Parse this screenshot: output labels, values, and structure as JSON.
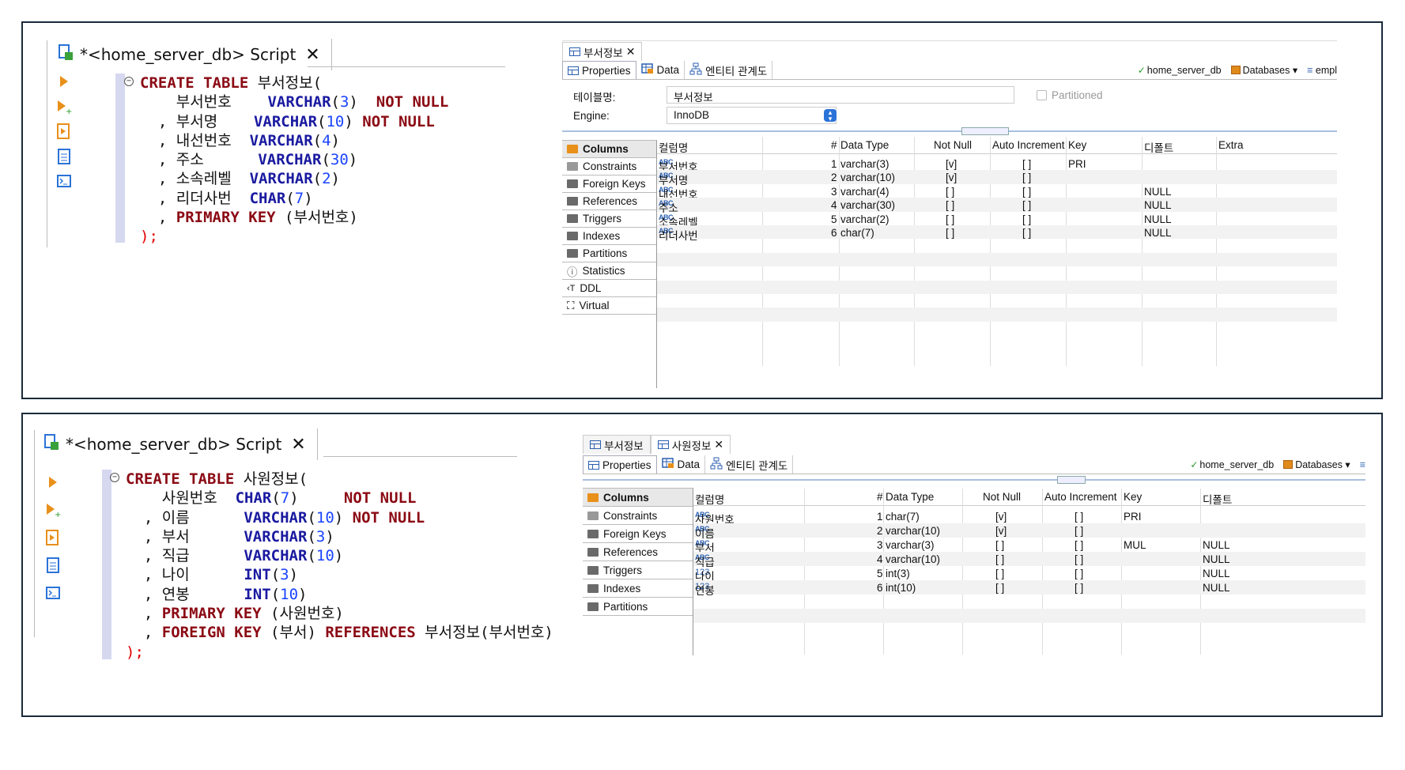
{
  "panel1": {
    "editor_tab": {
      "title": "*<home_server_db> Script"
    },
    "code_lines": [
      {
        "parts": [
          {
            "t": "CREATE TABLE ",
            "c": "kw"
          },
          {
            "t": "부서정보(",
            "c": ""
          }
        ]
      },
      {
        "parts": [
          {
            "t": "    부서번호    ",
            "c": ""
          },
          {
            "t": "VARCHAR",
            "c": "ty"
          },
          {
            "t": "(",
            "c": ""
          },
          {
            "t": "3",
            "c": "num"
          },
          {
            "t": ")  ",
            "c": ""
          },
          {
            "t": "NOT NULL",
            "c": "kw"
          }
        ]
      },
      {
        "parts": [
          {
            "t": "  , 부서명    ",
            "c": ""
          },
          {
            "t": "VARCHAR",
            "c": "ty"
          },
          {
            "t": "(",
            "c": ""
          },
          {
            "t": "10",
            "c": "num"
          },
          {
            "t": ") ",
            "c": ""
          },
          {
            "t": "NOT NULL",
            "c": "kw"
          }
        ]
      },
      {
        "parts": [
          {
            "t": "  , 내선번호  ",
            "c": ""
          },
          {
            "t": "VARCHAR",
            "c": "ty"
          },
          {
            "t": "(",
            "c": ""
          },
          {
            "t": "4",
            "c": "num"
          },
          {
            "t": ")",
            "c": ""
          }
        ]
      },
      {
        "parts": [
          {
            "t": "  , 주소      ",
            "c": ""
          },
          {
            "t": "VARCHAR",
            "c": "ty"
          },
          {
            "t": "(",
            "c": ""
          },
          {
            "t": "30",
            "c": "num"
          },
          {
            "t": ")",
            "c": ""
          }
        ]
      },
      {
        "parts": [
          {
            "t": "  , 소속레벨  ",
            "c": ""
          },
          {
            "t": "VARCHAR",
            "c": "ty"
          },
          {
            "t": "(",
            "c": ""
          },
          {
            "t": "2",
            "c": "num"
          },
          {
            "t": ")",
            "c": ""
          }
        ]
      },
      {
        "parts": [
          {
            "t": "  , 리더사번  ",
            "c": ""
          },
          {
            "t": "CHAR",
            "c": "ty"
          },
          {
            "t": "(",
            "c": ""
          },
          {
            "t": "7",
            "c": "num"
          },
          {
            "t": ")",
            "c": ""
          }
        ]
      },
      {
        "parts": [
          {
            "t": "  , ",
            "c": ""
          },
          {
            "t": "PRIMARY KEY",
            "c": "kw"
          },
          {
            "t": " (부서번호)",
            "c": ""
          }
        ]
      },
      {
        "parts": [
          {
            "t": ");",
            "c": "red"
          }
        ]
      }
    ],
    "tabs": [
      {
        "label": "부서정보",
        "closable": true,
        "active": true
      }
    ],
    "subtabs": [
      {
        "label": "Properties",
        "active": true
      },
      {
        "label": "Data"
      },
      {
        "label": "엔티티 관계도"
      }
    ],
    "crumbs": {
      "db": "home_server_db",
      "databases": "Databases",
      "extra": "empl"
    },
    "fields": {
      "table_name_label": "테이블명:",
      "table_name_value": "부서정보",
      "engine_label": "Engine:",
      "engine_value": "InnoDB",
      "partitioned_label": "Partitioned"
    },
    "left_items": [
      "Columns",
      "Constraints",
      "Foreign Keys",
      "References",
      "Triggers",
      "Indexes",
      "Partitions",
      "Statistics",
      "DDL",
      "Virtual"
    ],
    "headers": {
      "name": "컬럼명",
      "num": "#",
      "type": "Data Type",
      "notnull": "Not Null",
      "auto": "Auto Increment",
      "key": "Key",
      "default": "디폴트",
      "extra": "Extra"
    },
    "rows": [
      {
        "icon": "abc-key",
        "name": "부서번호",
        "num": "1",
        "type": "varchar(3)",
        "notnull": "[v]",
        "auto": "[ ]",
        "key": "PRI",
        "default": ""
      },
      {
        "icon": "abc",
        "name": "부서명",
        "num": "2",
        "type": "varchar(10)",
        "notnull": "[v]",
        "auto": "[ ]",
        "key": "",
        "default": ""
      },
      {
        "icon": "abc",
        "name": "내선번호",
        "num": "3",
        "type": "varchar(4)",
        "notnull": "[ ]",
        "auto": "[ ]",
        "key": "",
        "default": "NULL"
      },
      {
        "icon": "abc",
        "name": "주소",
        "num": "4",
        "type": "varchar(30)",
        "notnull": "[ ]",
        "auto": "[ ]",
        "key": "",
        "default": "NULL"
      },
      {
        "icon": "abc",
        "name": "소속레벨",
        "num": "5",
        "type": "varchar(2)",
        "notnull": "[ ]",
        "auto": "[ ]",
        "key": "",
        "default": "NULL"
      },
      {
        "icon": "abc",
        "name": "리더사번",
        "num": "6",
        "type": "char(7)",
        "notnull": "[ ]",
        "auto": "[ ]",
        "key": "",
        "default": "NULL"
      }
    ]
  },
  "panel2": {
    "editor_tab": {
      "title": "*<home_server_db> Script"
    },
    "code_lines": [
      {
        "parts": [
          {
            "t": "CREATE TABLE ",
            "c": "kw"
          },
          {
            "t": "사원정보(",
            "c": ""
          }
        ]
      },
      {
        "parts": [
          {
            "t": "    사원번호  ",
            "c": ""
          },
          {
            "t": "CHAR",
            "c": "ty"
          },
          {
            "t": "(",
            "c": ""
          },
          {
            "t": "7",
            "c": "num"
          },
          {
            "t": ")     ",
            "c": ""
          },
          {
            "t": "NOT NULL",
            "c": "kw"
          }
        ]
      },
      {
        "parts": [
          {
            "t": "  , 이름      ",
            "c": ""
          },
          {
            "t": "VARCHAR",
            "c": "ty"
          },
          {
            "t": "(",
            "c": ""
          },
          {
            "t": "10",
            "c": "num"
          },
          {
            "t": ") ",
            "c": ""
          },
          {
            "t": "NOT NULL",
            "c": "kw"
          }
        ]
      },
      {
        "parts": [
          {
            "t": "  , 부서      ",
            "c": ""
          },
          {
            "t": "VARCHAR",
            "c": "ty"
          },
          {
            "t": "(",
            "c": ""
          },
          {
            "t": "3",
            "c": "num"
          },
          {
            "t": ")",
            "c": ""
          }
        ]
      },
      {
        "parts": [
          {
            "t": "  , 직급      ",
            "c": ""
          },
          {
            "t": "VARCHAR",
            "c": "ty"
          },
          {
            "t": "(",
            "c": ""
          },
          {
            "t": "10",
            "c": "num"
          },
          {
            "t": ")",
            "c": ""
          }
        ]
      },
      {
        "parts": [
          {
            "t": "  , 나이      ",
            "c": ""
          },
          {
            "t": "INT",
            "c": "ty"
          },
          {
            "t": "(",
            "c": ""
          },
          {
            "t": "3",
            "c": "num"
          },
          {
            "t": ")",
            "c": ""
          }
        ]
      },
      {
        "parts": [
          {
            "t": "  , 연봉      ",
            "c": ""
          },
          {
            "t": "INT",
            "c": "ty"
          },
          {
            "t": "(",
            "c": ""
          },
          {
            "t": "10",
            "c": "num"
          },
          {
            "t": ")",
            "c": ""
          }
        ]
      },
      {
        "parts": [
          {
            "t": "  , ",
            "c": ""
          },
          {
            "t": "PRIMARY KEY",
            "c": "kw"
          },
          {
            "t": " (사원번호)",
            "c": ""
          }
        ]
      },
      {
        "parts": [
          {
            "t": "  , ",
            "c": ""
          },
          {
            "t": "FOREIGN KEY",
            "c": "kw"
          },
          {
            "t": " (부서) ",
            "c": ""
          },
          {
            "t": "REFERENCES",
            "c": "kw"
          },
          {
            "t": " 부서정보(부서번호)",
            "c": ""
          }
        ]
      },
      {
        "parts": [
          {
            "t": ");",
            "c": "red"
          }
        ]
      }
    ],
    "tabs": [
      {
        "label": "부서정보",
        "closable": false,
        "active": false
      },
      {
        "label": "사원정보",
        "closable": true,
        "active": true
      }
    ],
    "subtabs": [
      {
        "label": "Properties",
        "active": true
      },
      {
        "label": "Data"
      },
      {
        "label": "엔티티 관계도"
      }
    ],
    "crumbs": {
      "db": "home_server_db",
      "databases": "Databases"
    },
    "left_items": [
      "Columns",
      "Constraints",
      "Foreign Keys",
      "References",
      "Triggers",
      "Indexes",
      "Partitions"
    ],
    "headers": {
      "name": "컬럼명",
      "num": "#",
      "type": "Data Type",
      "notnull": "Not Null",
      "auto": "Auto Increment",
      "key": "Key",
      "default": "디폴트"
    },
    "rows": [
      {
        "icon": "abc-key",
        "name": "사원번호",
        "num": "1",
        "type": "char(7)",
        "notnull": "[v]",
        "auto": "[ ]",
        "key": "PRI",
        "default": ""
      },
      {
        "icon": "abc",
        "name": "이름",
        "num": "2",
        "type": "varchar(10)",
        "notnull": "[v]",
        "auto": "[ ]",
        "key": "",
        "default": ""
      },
      {
        "icon": "abc-key",
        "name": "부서",
        "num": "3",
        "type": "varchar(3)",
        "notnull": "[ ]",
        "auto": "[ ]",
        "key": "MUL",
        "default": "NULL"
      },
      {
        "icon": "abc",
        "name": "직급",
        "num": "4",
        "type": "varchar(10)",
        "notnull": "[ ]",
        "auto": "[ ]",
        "key": "",
        "default": "NULL"
      },
      {
        "icon": "123",
        "name": "나이",
        "num": "5",
        "type": "int(3)",
        "notnull": "[ ]",
        "auto": "[ ]",
        "key": "",
        "default": "NULL"
      },
      {
        "icon": "123",
        "name": "연봉",
        "num": "6",
        "type": "int(10)",
        "notnull": "[ ]",
        "auto": "[ ]",
        "key": "",
        "default": "NULL"
      }
    ]
  }
}
